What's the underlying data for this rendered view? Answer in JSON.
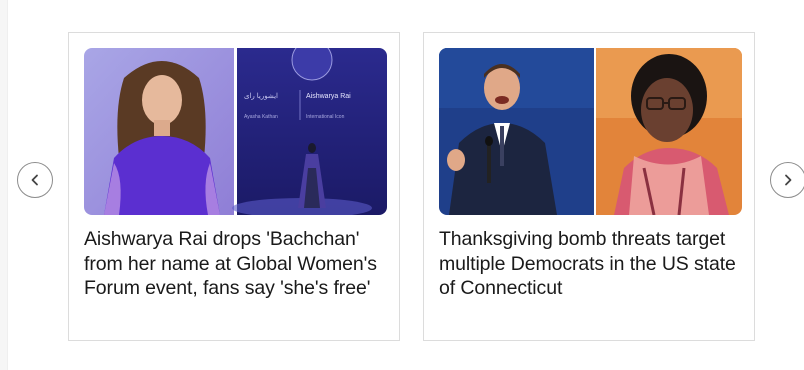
{
  "carousel": {
    "prev_icon": "chevron-left-icon",
    "next_icon": "chevron-right-icon",
    "cards": [
      {
        "headline": "Aishwarya Rai drops 'Bachchan' from her name at Global Women's Forum event, fans say 'she's free'",
        "image": {
          "name_label": "Aishwarya Rai",
          "role_label": "International Icon"
        }
      },
      {
        "headline": "Thanksgiving bomb threats target multiple Democrats in the US state of Connecticut"
      }
    ]
  },
  "colors": {
    "border": "#dcdcdc",
    "text": "#1a1a1a",
    "nav_border": "#8c8c8c"
  }
}
